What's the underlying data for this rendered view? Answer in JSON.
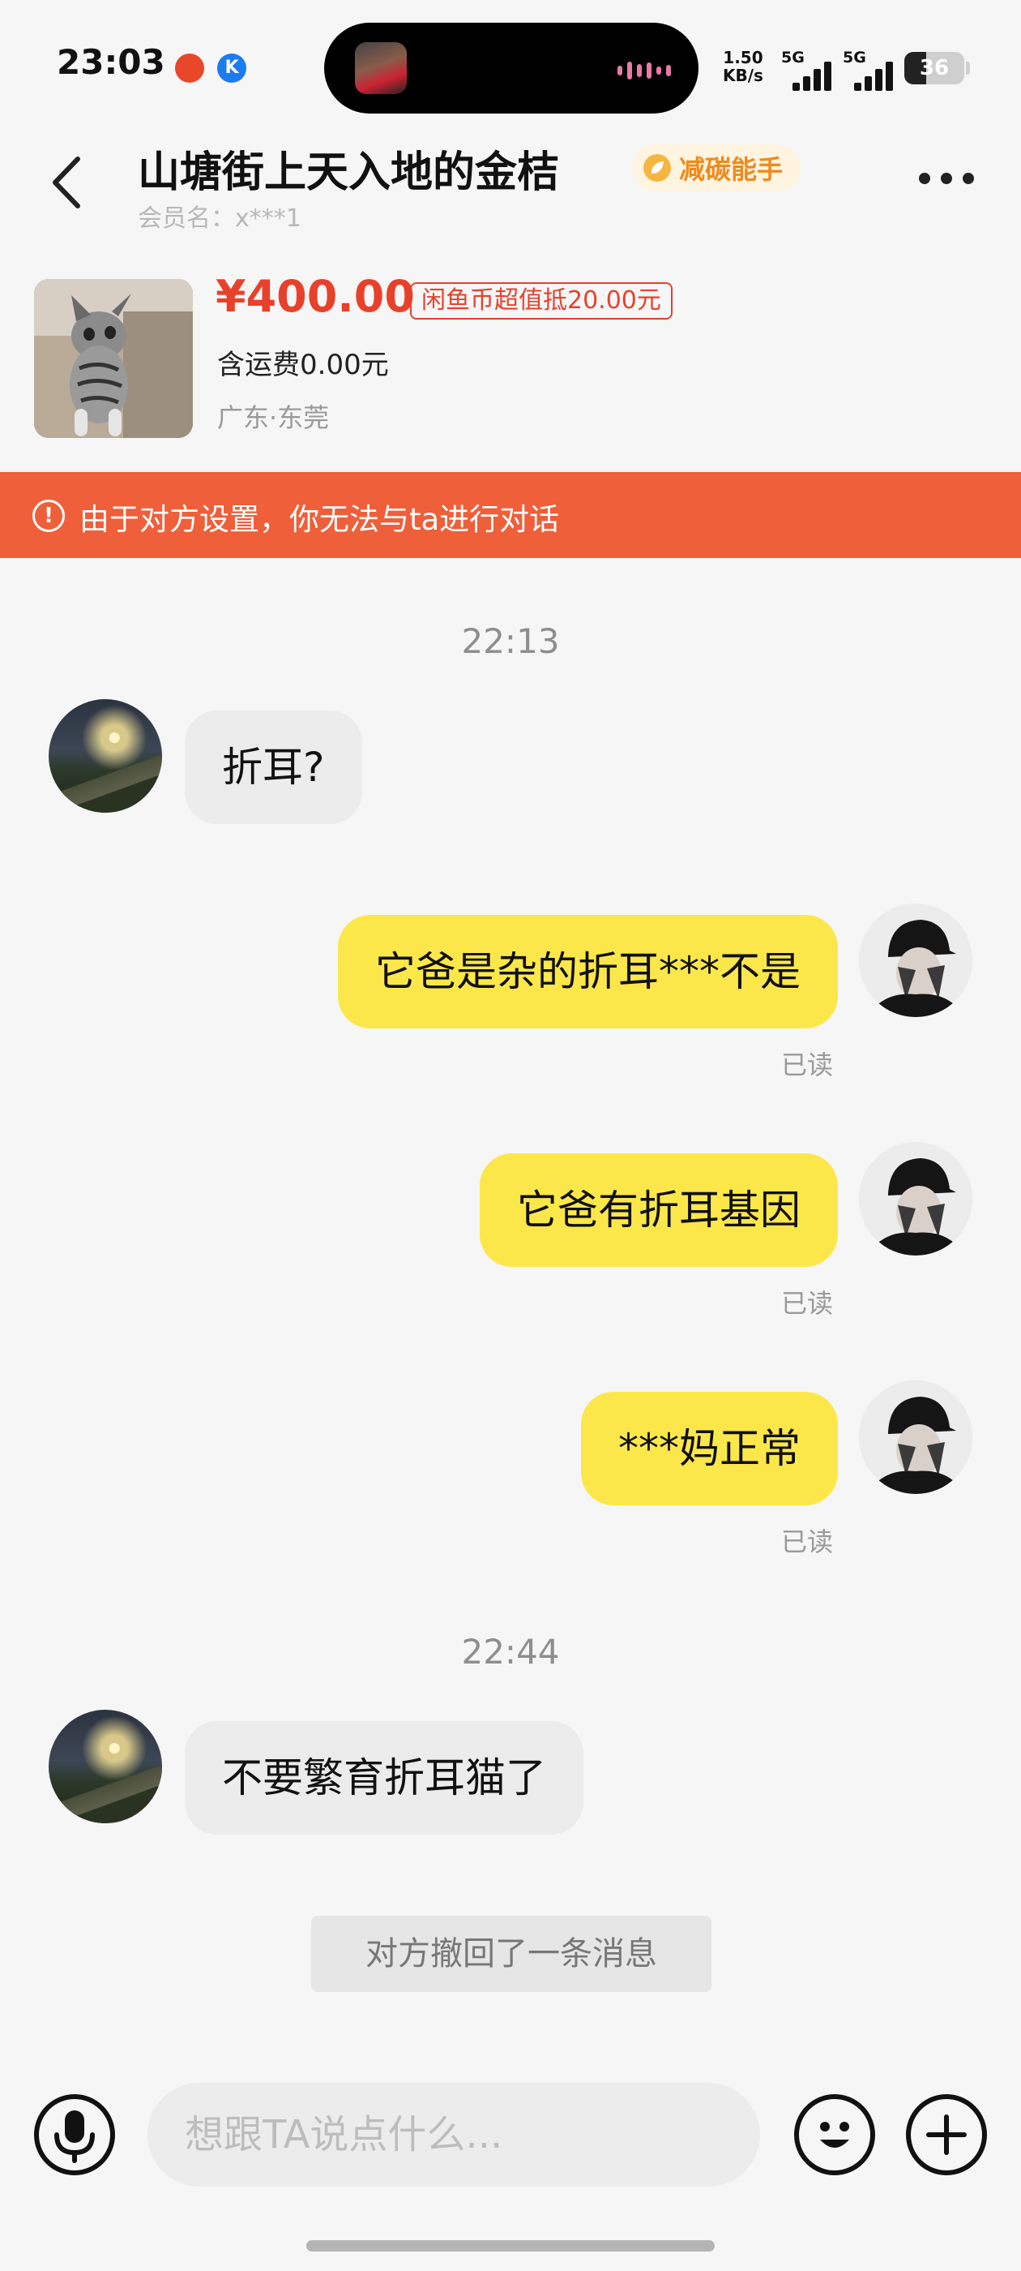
{
  "status_bar": {
    "time": "23:03",
    "net_speed_value": "1.50",
    "net_speed_unit": "KB/s",
    "sim1_label": "5G",
    "sim2_label": "5G",
    "battery_level": "36",
    "battery_fraction": 0.36
  },
  "header": {
    "title": "山塘街上天入地的金桔",
    "badge": "减碳能手",
    "member_label": "会员名：x***1"
  },
  "product": {
    "price": "¥400.00",
    "coin_tag": "闲鱼币超值抵20.00元",
    "shipping": "含运费0.00元",
    "location": "广东·东莞"
  },
  "banner": {
    "icon": "!",
    "text": "由于对方设置，你无法与ta进行对话"
  },
  "chat": {
    "timestamps": [
      "22:13",
      "22:44"
    ],
    "messages": [
      {
        "from": "other",
        "text": "折耳?"
      },
      {
        "from": "me",
        "text": "它爸是杂的折耳***不是",
        "status": "已读"
      },
      {
        "from": "me",
        "text": "它爸有折耳基因",
        "status": "已读"
      },
      {
        "from": "me",
        "text": "***妈正常",
        "status": "已读"
      },
      {
        "from": "other",
        "text": "不要繁育折耳猫了"
      }
    ],
    "recall_notice": "对方撤回了一条消息"
  },
  "input_bar": {
    "placeholder": "想跟TA说点什么..."
  },
  "colors": {
    "price": "#e8412b",
    "banner": "#ee5f3a",
    "bubble_out": "#fce74a",
    "bubble_in": "#ececec",
    "badge_text": "#f08a1c"
  }
}
